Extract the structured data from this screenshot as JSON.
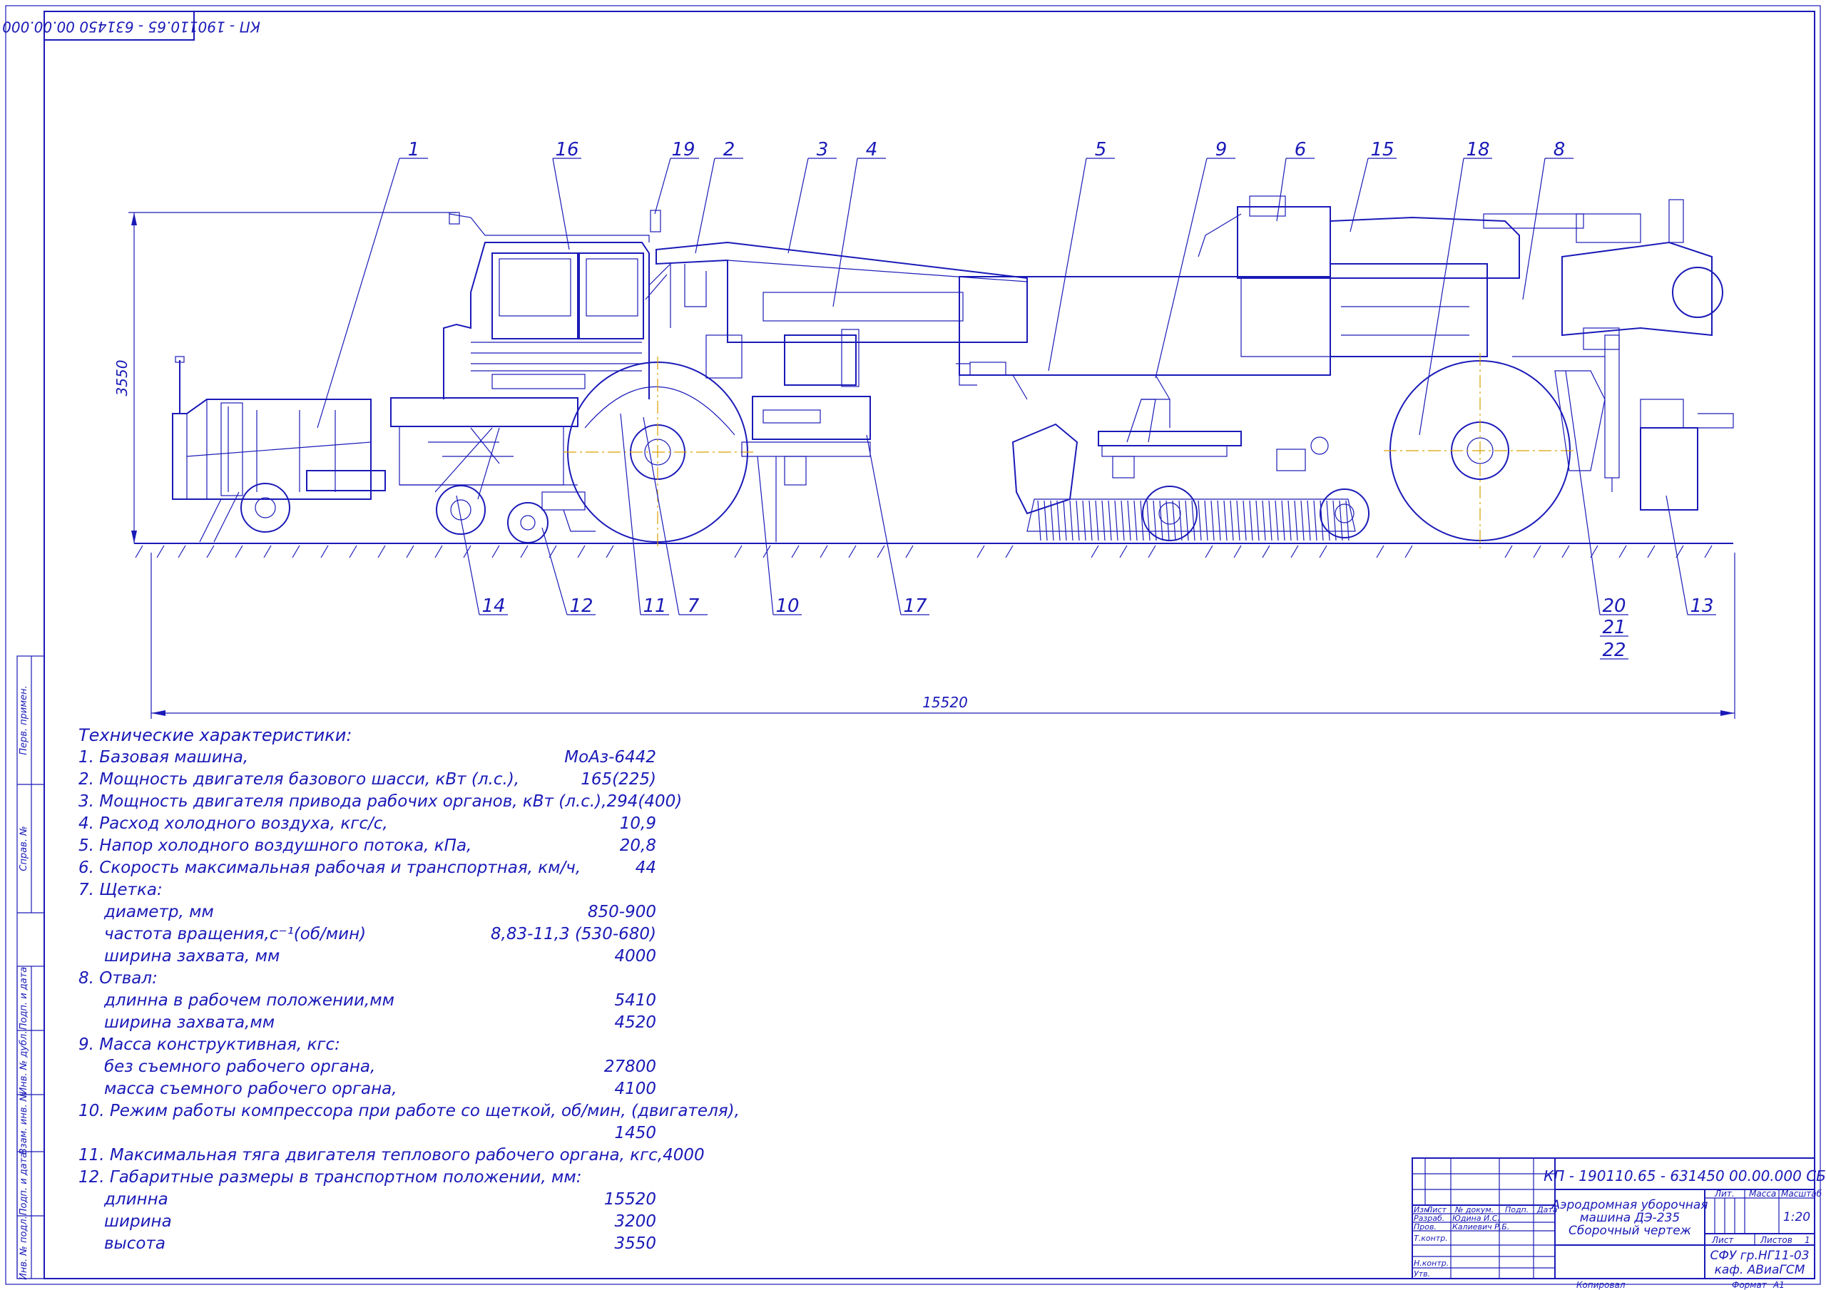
{
  "stamp_top": "КП - 190110.65 - 631450 00.00.000 СБ",
  "callouts": [
    "1",
    "16",
    "19",
    "2",
    "3",
    "4",
    "5",
    "9",
    "6",
    "15",
    "18",
    "8",
    "14",
    "12",
    "11",
    "7",
    "10",
    "17",
    "20",
    "21",
    "22",
    "13"
  ],
  "dimensions": {
    "height": "3550",
    "length": "15520"
  },
  "specs_title": "Технические  характеристики:",
  "specs": [
    {
      "label": "1. Базовая машина,",
      "value": "МоАз-6442",
      "indent": false
    },
    {
      "label": "2. Мощность двигателя базового шасси, кВт (л.с.),",
      "value": "165(225)",
      "indent": false
    },
    {
      "label": "3. Мощность двигателя привода рабочих органов, кВт (л.с.),",
      "value": "294(400)",
      "indent": false
    },
    {
      "label": "4. Расход холодного воздуха, кгс/с,",
      "value": "10,9",
      "indent": false
    },
    {
      "label": "5. Напор холодного воздушного потока, кПа,",
      "value": "20,8",
      "indent": false
    },
    {
      "label": "6. Скорость максимальная рабочая и транспортная, км/ч,",
      "value": "44",
      "indent": false
    },
    {
      "label": "7. Щетка:",
      "value": "",
      "indent": false
    },
    {
      "label": "диаметр, мм",
      "value": "850-900",
      "indent": true
    },
    {
      "label": "частота вращения,с⁻¹(об/мин)",
      "value": "8,83-11,3 (530-680)",
      "indent": true
    },
    {
      "label": "ширина захвата, мм",
      "value": "4000",
      "indent": true
    },
    {
      "label": "8. Отвал:",
      "value": "",
      "indent": false
    },
    {
      "label": "длинна в рабочем положении,мм",
      "value": "5410",
      "indent": true
    },
    {
      "label": "ширина захвата,мм",
      "value": "4520",
      "indent": true
    },
    {
      "label": "9. Масса конструктивная, кгс:",
      "value": "",
      "indent": false
    },
    {
      "label": "без съемного рабочего органа,",
      "value": "27800",
      "indent": true
    },
    {
      "label": "масса съемного рабочего органа,",
      "value": "4100",
      "indent": true
    },
    {
      "label": "10. Режим работы компрессора при работе со щеткой, об/мин, (двигателя),",
      "value": "",
      "indent": false
    },
    {
      "label": "",
      "value": "1450",
      "indent": false
    },
    {
      "label": "11. Максимальная тяга двигателя теплового рабочего органа, кгс,",
      "value": "4000",
      "indent": false
    },
    {
      "label": "12. Габаритные размеры в транспортном положении, мм:",
      "value": "",
      "indent": false
    },
    {
      "label": "длинна",
      "value": "15520",
      "indent": true
    },
    {
      "label": "ширина",
      "value": "3200",
      "indent": true
    },
    {
      "label": "высота",
      "value": "3550",
      "indent": true
    }
  ],
  "side_labels": [
    "Перв. примен.",
    "Справ. №",
    "Подп. и дата",
    "Инв. № дубл.",
    "Взам. инв. №",
    "Подп. и дата",
    "Инв. № подл."
  ],
  "title_block": {
    "code": "КП - 190110.65 - 631450 00.00.000 СБ",
    "name_line1": "Аэродромная уборочная",
    "name_line2": "машина ДЭ-235",
    "name_line3": "Сборочный чертеж",
    "lit": "Лит.",
    "mass": "Масса",
    "scale_label": "Масштаб",
    "scale": "1:20",
    "sheet": "Лист",
    "sheets": "Листов",
    "sheets_count": "1",
    "org1": "СФУ гр.НГ11-03",
    "org2": "каф. АВиаГСМ",
    "copied": "Копировал",
    "format": "Формат",
    "format_value": "А1",
    "cols": [
      "Изм.",
      "Лист",
      "№ докум.",
      "Подп.",
      "Дата"
    ],
    "roles": [
      "Разраб.",
      "Пров.",
      "Т.контр.",
      "",
      "Н.контр.",
      "Утв."
    ],
    "people": [
      "Юдина И.С.",
      "Калиевич Р.Б."
    ]
  }
}
